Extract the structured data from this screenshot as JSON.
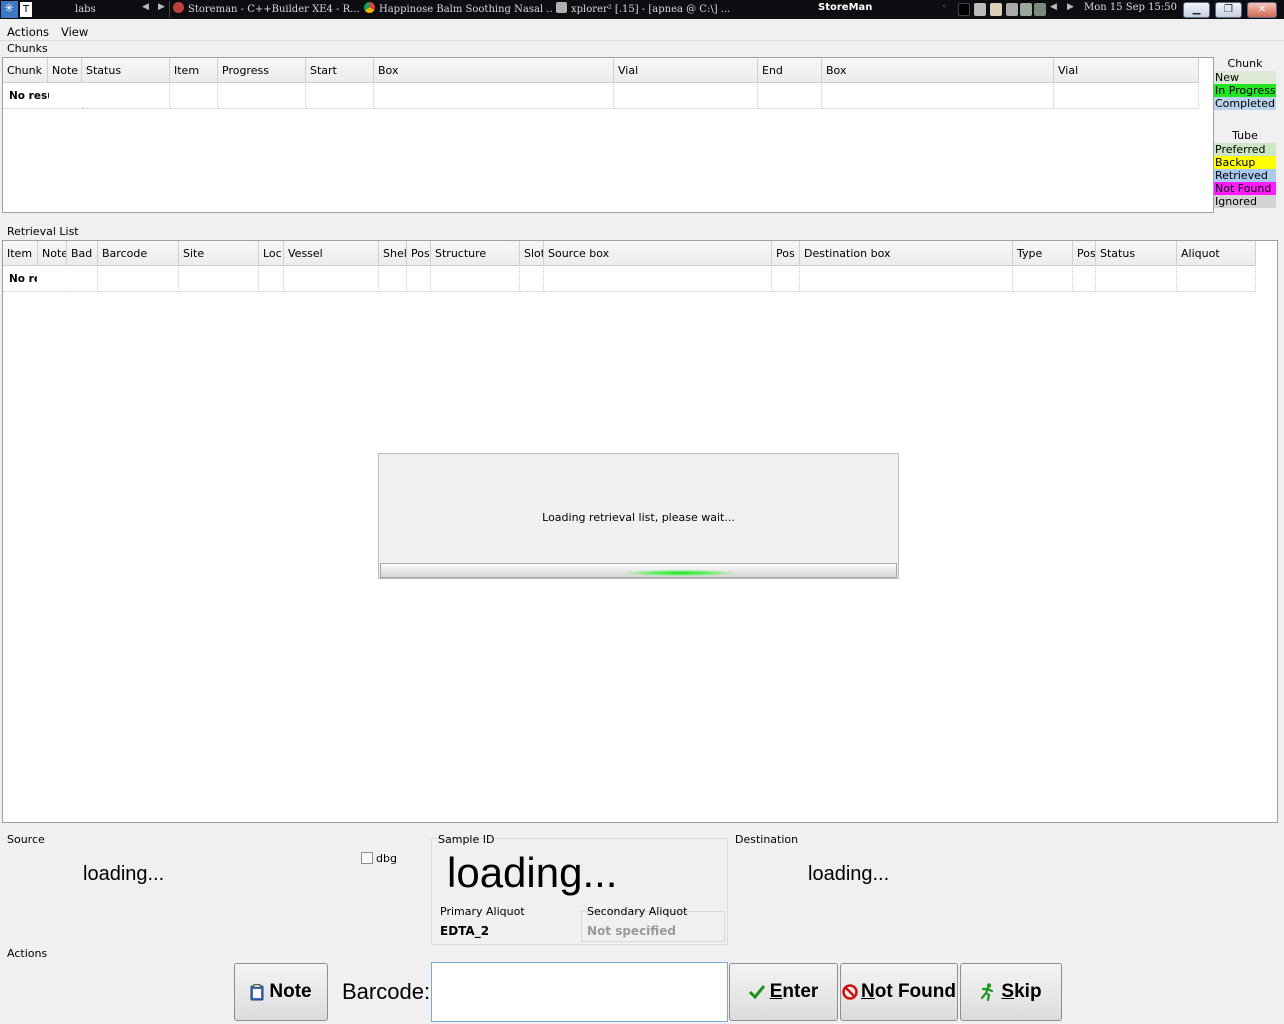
{
  "taskbar": {
    "start_glyph": "T",
    "items": [
      {
        "label": "labs"
      },
      {
        "label": "Storeman - C++Builder XE4 - R..."
      },
      {
        "label": "Happinose Balm Soothing Nasal ..."
      },
      {
        "label": "xplorer² [.15] - [apnea @ C:\\] ..."
      }
    ],
    "window_title": "StoreMan",
    "clock": "Mon 15 Sep 15:50"
  },
  "menu": {
    "actions": "Actions",
    "view": "View"
  },
  "chunks": {
    "group_label": "Chunks",
    "columns": [
      "Chunk",
      "Note",
      "Status",
      "Item",
      "Progress",
      "Start",
      "Box",
      "Vial",
      "End",
      "Box",
      "Vial"
    ],
    "no_results": "No resu"
  },
  "legend": {
    "chunk_title": "Chunk",
    "chunk_items": [
      {
        "label": "New",
        "color": "#dde9d5"
      },
      {
        "label": "In Progress",
        "color": "#22e622"
      },
      {
        "label": "Completed",
        "color": "#b9d3ee"
      }
    ],
    "tube_title": "Tube",
    "tube_items": [
      {
        "label": "Preferred",
        "color": "#cde7c6"
      },
      {
        "label": "Backup",
        "color": "#ffff00"
      },
      {
        "label": "Retrieved",
        "color": "#a9c9ee"
      },
      {
        "label": "Not Found",
        "color": "#ff1aff"
      },
      {
        "label": "Ignored",
        "color": "#d3d3d3"
      }
    ]
  },
  "retrieval": {
    "group_label": "Retrieval List",
    "columns": [
      "Item",
      "Note",
      "Bad",
      "Barcode",
      "Site",
      "Loc",
      "Vessel",
      "Shelf",
      "Pos",
      "Structure",
      "Slot",
      "Source box",
      "Pos",
      "Destination box",
      "Type",
      "Pos",
      "Status",
      "Aliquot"
    ],
    "no_results": "No re"
  },
  "dialog": {
    "message": "Loading retrieval list, please wait...",
    "progress_fraction": 0.5
  },
  "source": {
    "label": "Source",
    "value": "loading...",
    "dbg_label": "dbg"
  },
  "sample": {
    "label": "Sample ID",
    "value": "loading...",
    "primary_label": "Primary Aliquot",
    "primary_value": "EDTA_2",
    "secondary_label": "Secondary Aliquot",
    "secondary_value": "Not specified"
  },
  "destination": {
    "label": "Destination",
    "value": "loading..."
  },
  "actions": {
    "label": "Actions",
    "note": "Note",
    "barcode_label": "Barcode:",
    "barcode_value": "",
    "enter": "Enter",
    "not_found": "Not Found",
    "skip": "Skip"
  }
}
